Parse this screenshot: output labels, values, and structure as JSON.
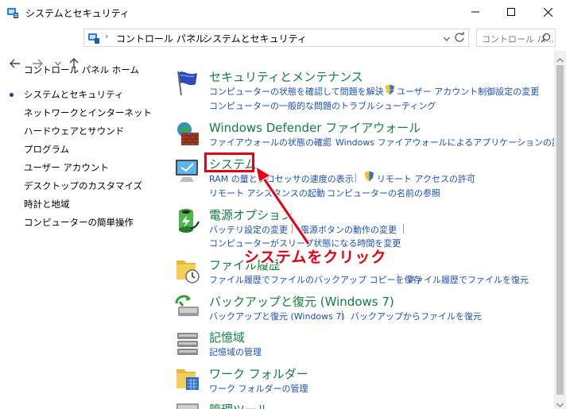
{
  "window": {
    "title": "システムとセキュリティ",
    "controls": [
      "minimize-icon",
      "maximize-icon",
      "close-icon"
    ]
  },
  "address": {
    "crumbs": [
      "コントロール パネル",
      "システムとセキュリティ"
    ],
    "search_placeholder": "コントロール パ...",
    "icons": [
      "back-arrow-icon",
      "forward-arrow-icon",
      "recent-dropdown-icon",
      "up-arrow-icon",
      "control-panel-icon",
      "refresh-icon",
      "search-icon"
    ]
  },
  "sidebar": {
    "items": [
      {
        "label": "コントロール パネル ホーム",
        "selected": false
      },
      {
        "label": "システムとセキュリティ",
        "selected": true
      },
      {
        "label": "ネットワークとインターネット",
        "selected": false
      },
      {
        "label": "ハードウェアとサウンド",
        "selected": false
      },
      {
        "label": "プログラム",
        "selected": false
      },
      {
        "label": "ユーザー アカウント",
        "selected": false
      },
      {
        "label": "デスクトップのカスタマイズ",
        "selected": false
      },
      {
        "label": "時計と地域",
        "selected": false
      },
      {
        "label": "コンピューターの簡単操作",
        "selected": false
      }
    ]
  },
  "categories": [
    {
      "title": "セキュリティとメンテナンス",
      "icon": "security-flag-icon",
      "links": [
        "コンピューターの状態を確認して問題を解決",
        "ユーザー アカウント制御設定の変更",
        "コンピューターの一般的な問題のトラブルシューティング"
      ]
    },
    {
      "title": "Windows Defender ファイアウォール",
      "icon": "firewall-icon",
      "links": [
        "ファイアウォールの状態の確認",
        "Windows ファイアウォールによるアプリケーションの許可"
      ]
    },
    {
      "title": "システム",
      "icon": "system-computer-icon",
      "links": [
        "RAM の量とプロセッサの速度の表示",
        "リモート アクセスの許可",
        "リモート アシスタンスの起動",
        "コンピューターの名前の参照"
      ]
    },
    {
      "title": "電源オプション",
      "icon": "battery-icon",
      "links": [
        "バッテリ設定の変更",
        "電源ボタンの動作の変更",
        "コンピューターがスリープ状態になる時間を変更"
      ]
    },
    {
      "title": "ファイル履歴",
      "icon": "file-history-icon",
      "links": [
        "ファイル履歴でファイルのバックアップ コピーを保存",
        "ファイル履歴でファイルを復元"
      ]
    },
    {
      "title": "バックアップと復元 (Windows 7)",
      "icon": "backup-icon",
      "links": [
        "バックアップと復元 (Windows 7)",
        "バックアップからファイルを復元"
      ]
    },
    {
      "title": "記憶域",
      "icon": "storage-icon",
      "links": [
        "記憶域の管理"
      ]
    },
    {
      "title": "ワーク フォルダー",
      "icon": "work-folders-icon",
      "links": [
        "ワーク フォルダーの管理"
      ]
    },
    {
      "title": "管理ツール",
      "icon": "admin-tools-icon",
      "links": []
    }
  ],
  "annotation": {
    "callout_text": "システムをクリック",
    "color": "#e60012"
  },
  "colors": {
    "category_title": "#108040",
    "link": "#1a50b8"
  }
}
